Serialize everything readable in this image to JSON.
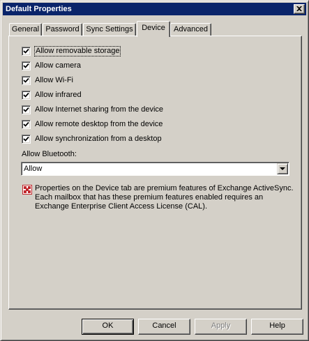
{
  "window": {
    "title": "Default Properties"
  },
  "tabs": [
    {
      "label": "General"
    },
    {
      "label": "Password"
    },
    {
      "label": "Sync Settings"
    },
    {
      "label": "Device",
      "active": true
    },
    {
      "label": "Advanced"
    }
  ],
  "device": {
    "options": [
      {
        "label": "Allow removable storage",
        "checked": true
      },
      {
        "label": "Allow camera",
        "checked": true
      },
      {
        "label": "Allow Wi-Fi",
        "checked": true
      },
      {
        "label": "Allow infrared",
        "checked": true
      },
      {
        "label": "Allow Internet sharing from the device",
        "checked": true
      },
      {
        "label": "Allow remote desktop from the device",
        "checked": true
      },
      {
        "label": "Allow synchronization from a desktop",
        "checked": true
      }
    ],
    "bluetooth": {
      "label": "Allow Bluetooth:",
      "selected": "Allow"
    },
    "notice": {
      "lines": [
        "Properties on the Device tab are premium features of Exchange ActiveSync.",
        "Each mailbox that has these premium features enabled requires an",
        "Exchange Enterprise Client Access License (CAL)."
      ],
      "icon": "premium-feature-icon"
    }
  },
  "buttons": {
    "ok": "OK",
    "cancel": "Cancel",
    "apply": "Apply",
    "help": "Help"
  },
  "colors": {
    "title_bar": "#0a246a",
    "face": "#d4d0c8",
    "notice_icon": "#c0282d"
  }
}
